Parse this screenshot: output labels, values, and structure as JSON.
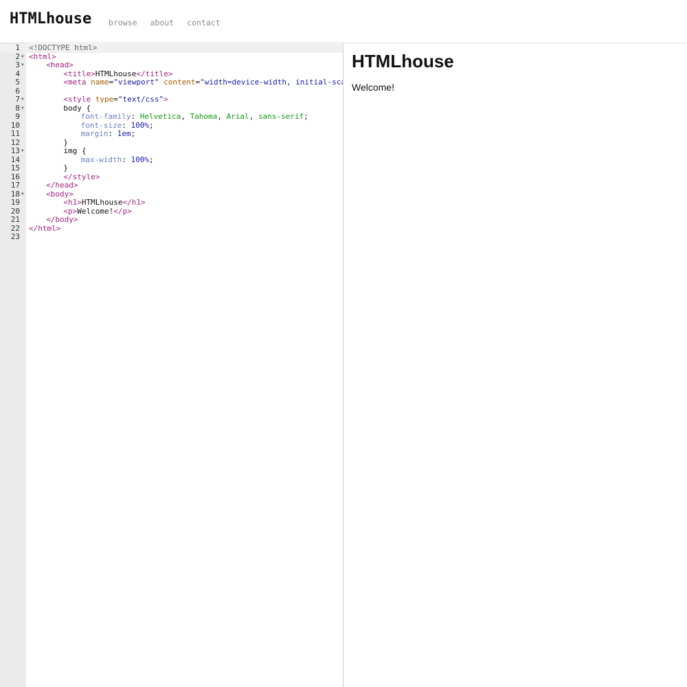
{
  "header": {
    "brand": "HTMLhouse",
    "nav": [
      {
        "label": "browse"
      },
      {
        "label": "about"
      },
      {
        "label": "contact"
      }
    ]
  },
  "editor": {
    "lines": [
      {
        "n": "1",
        "fold": false,
        "tokens": [
          {
            "t": "<!DOCTYPE html>",
            "c": "doctype"
          }
        ]
      },
      {
        "n": "2",
        "fold": true,
        "tokens": [
          {
            "t": "<html>",
            "c": "tag"
          }
        ]
      },
      {
        "n": "3",
        "fold": true,
        "indent": 1,
        "tokens": [
          {
            "t": "<head>",
            "c": "tag"
          }
        ]
      },
      {
        "n": "4",
        "fold": false,
        "indent": 2,
        "tokens": [
          {
            "t": "<title>",
            "c": "tag"
          },
          {
            "t": "HTMLhouse",
            "c": "plain"
          },
          {
            "t": "</title>",
            "c": "tag"
          }
        ]
      },
      {
        "n": "5",
        "fold": false,
        "indent": 2,
        "tokens": [
          {
            "t": "<meta ",
            "c": "tag"
          },
          {
            "t": "name",
            "c": "attr"
          },
          {
            "t": "=",
            "c": "plain"
          },
          {
            "t": "\"viewport\"",
            "c": "str"
          },
          {
            "t": " ",
            "c": "plain"
          },
          {
            "t": "content",
            "c": "attr"
          },
          {
            "t": "=",
            "c": "plain"
          },
          {
            "t": "\"width=device-width, initial-scale=",
            "c": "str"
          }
        ]
      },
      {
        "n": "6",
        "fold": false,
        "tokens": []
      },
      {
        "n": "7",
        "fold": true,
        "indent": 2,
        "tokens": [
          {
            "t": "<style ",
            "c": "tag"
          },
          {
            "t": "type",
            "c": "attr"
          },
          {
            "t": "=",
            "c": "plain"
          },
          {
            "t": "\"text/css\"",
            "c": "str"
          },
          {
            "t": ">",
            "c": "tag"
          }
        ]
      },
      {
        "n": "8",
        "fold": true,
        "indent": 2,
        "tokens": [
          {
            "t": "body {",
            "c": "plain"
          }
        ]
      },
      {
        "n": "9",
        "fold": false,
        "indent": 3,
        "tokens": [
          {
            "t": "font-family",
            "c": "prop"
          },
          {
            "t": ": ",
            "c": "plain"
          },
          {
            "t": "Helvetica",
            "c": "val"
          },
          {
            "t": ", ",
            "c": "plain"
          },
          {
            "t": "Tahoma",
            "c": "val"
          },
          {
            "t": ", ",
            "c": "plain"
          },
          {
            "t": "Arial",
            "c": "val"
          },
          {
            "t": ", ",
            "c": "plain"
          },
          {
            "t": "sans-serif",
            "c": "val"
          },
          {
            "t": ";",
            "c": "plain"
          }
        ]
      },
      {
        "n": "10",
        "fold": false,
        "indent": 3,
        "tokens": [
          {
            "t": "font-size",
            "c": "prop"
          },
          {
            "t": ": ",
            "c": "plain"
          },
          {
            "t": "100%",
            "c": "num"
          },
          {
            "t": ";",
            "c": "plain"
          }
        ]
      },
      {
        "n": "11",
        "fold": false,
        "indent": 3,
        "tokens": [
          {
            "t": "margin",
            "c": "prop"
          },
          {
            "t": ": ",
            "c": "plain"
          },
          {
            "t": "1em",
            "c": "num"
          },
          {
            "t": ";",
            "c": "plain"
          }
        ]
      },
      {
        "n": "12",
        "fold": false,
        "indent": 2,
        "tokens": [
          {
            "t": "}",
            "c": "plain"
          }
        ]
      },
      {
        "n": "13",
        "fold": true,
        "indent": 2,
        "tokens": [
          {
            "t": "img {",
            "c": "plain"
          }
        ]
      },
      {
        "n": "14",
        "fold": false,
        "indent": 3,
        "tokens": [
          {
            "t": "max-width",
            "c": "prop"
          },
          {
            "t": ": ",
            "c": "plain"
          },
          {
            "t": "100%",
            "c": "num"
          },
          {
            "t": ";",
            "c": "plain"
          }
        ]
      },
      {
        "n": "15",
        "fold": false,
        "indent": 2,
        "tokens": [
          {
            "t": "}",
            "c": "plain"
          }
        ]
      },
      {
        "n": "16",
        "fold": false,
        "indent": 2,
        "tokens": [
          {
            "t": "</style>",
            "c": "tag"
          }
        ]
      },
      {
        "n": "17",
        "fold": false,
        "indent": 1,
        "tokens": [
          {
            "t": "</head>",
            "c": "tag"
          }
        ]
      },
      {
        "n": "18",
        "fold": true,
        "indent": 1,
        "tokens": [
          {
            "t": "<body>",
            "c": "tag"
          }
        ]
      },
      {
        "n": "19",
        "fold": false,
        "indent": 2,
        "tokens": [
          {
            "t": "<h1>",
            "c": "tag"
          },
          {
            "t": "HTMLhouse",
            "c": "plain"
          },
          {
            "t": "</h1>",
            "c": "tag"
          }
        ]
      },
      {
        "n": "20",
        "fold": false,
        "indent": 2,
        "tokens": [
          {
            "t": "<p>",
            "c": "tag"
          },
          {
            "t": "Welcome!",
            "c": "plain"
          },
          {
            "t": "</p>",
            "c": "tag"
          }
        ]
      },
      {
        "n": "21",
        "fold": false,
        "indent": 1,
        "tokens": [
          {
            "t": "</body>",
            "c": "tag"
          }
        ]
      },
      {
        "n": "22",
        "fold": false,
        "tokens": [
          {
            "t": "</html>",
            "c": "tag"
          }
        ]
      },
      {
        "n": "23",
        "fold": false,
        "tokens": []
      }
    ]
  },
  "preview": {
    "heading": "HTMLhouse",
    "paragraph": "Welcome!"
  }
}
